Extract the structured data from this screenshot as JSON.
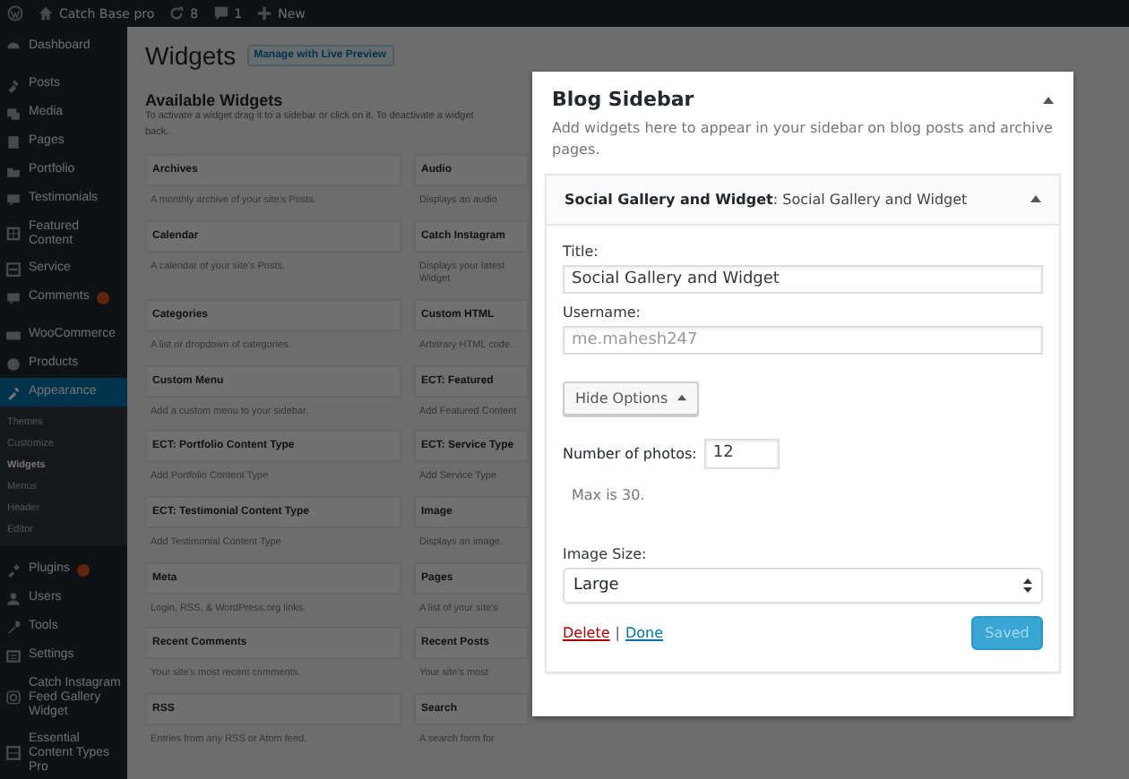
{
  "admin_bar": {
    "site": "Catch Base pro",
    "updates": "8",
    "comments": "1",
    "new": "New"
  },
  "sidebar": {
    "items": [
      {
        "label": "Dashboard",
        "selected": false,
        "badge": false
      },
      {
        "label": "Posts",
        "selected": false,
        "badge": false
      },
      {
        "label": "Media",
        "selected": false,
        "badge": false
      },
      {
        "label": "Pages",
        "selected": false,
        "badge": false
      },
      {
        "label": "Portfolio",
        "selected": false,
        "badge": false
      },
      {
        "label": "Testimonials",
        "selected": false,
        "badge": false
      },
      {
        "label": "Featured Content",
        "selected": false,
        "badge": false
      },
      {
        "label": "Service",
        "selected": false,
        "badge": false
      },
      {
        "label": "Comments",
        "selected": false,
        "badge": true
      },
      {
        "label": "WooCommerce",
        "selected": false,
        "badge": false
      },
      {
        "label": "Products",
        "selected": false,
        "badge": false
      },
      {
        "label": "Appearance",
        "selected": true,
        "badge": false,
        "children": [
          {
            "label": "Themes",
            "selected": false
          },
          {
            "label": "Customize",
            "selected": false
          },
          {
            "label": "Widgets",
            "selected": true
          },
          {
            "label": "Menus",
            "selected": false
          },
          {
            "label": "Header",
            "selected": false
          },
          {
            "label": "Editor",
            "selected": false
          }
        ]
      },
      {
        "label": "Plugins",
        "selected": false,
        "badge": true
      },
      {
        "label": "Users",
        "selected": false,
        "badge": false
      },
      {
        "label": "Tools",
        "selected": false,
        "badge": false
      },
      {
        "label": "Settings",
        "selected": false,
        "badge": false
      },
      {
        "label": "Catch Instagram Feed Gallery Widget",
        "selected": false,
        "badge": false
      },
      {
        "label": "Essential Content Types Pro",
        "selected": false,
        "badge": false
      }
    ]
  },
  "page": {
    "title": "Widgets",
    "action": "Manage with Live Preview"
  },
  "available_widgets": {
    "heading": "Available Widgets",
    "description_lines": [
      "To activate a widget drag it to a sidebar or click on it. To deactivate a widget",
      "back."
    ],
    "widgets": [
      {
        "title": "Archives",
        "description": "A monthly archive of your site's Posts."
      },
      {
        "title": "Audio",
        "description": "Displays an audio"
      },
      {
        "title": "Calendar",
        "description": "A calendar of your site's Posts."
      },
      {
        "title": "Catch Instagram",
        "description": "Displays your latest Widget"
      },
      {
        "title": "Categories",
        "description": "A list or dropdown of categories."
      },
      {
        "title": "Custom HTML",
        "description": "Arbitrary HTML code."
      },
      {
        "title": "Custom Menu",
        "description": "Add a custom menu to your sidebar."
      },
      {
        "title": "ECT: Featured",
        "description": "Add Featured Content"
      },
      {
        "title": "ECT: Portfolio Content Type",
        "description": "Add Portfolio Content Type"
      },
      {
        "title": "ECT: Service Type",
        "description": "Add Service Type"
      },
      {
        "title": "ECT: Testimonial Content Type",
        "description": "Add Testimonial Content Type"
      },
      {
        "title": "Image",
        "description": "Displays an image."
      },
      {
        "title": "Meta",
        "description": "Login, RSS, & WordPress.org links."
      },
      {
        "title": "Pages",
        "description": "A list of your site's"
      },
      {
        "title": "Recent Comments",
        "description": "Your site's most recent comments."
      },
      {
        "title": "Recent Posts",
        "description": "Your site's most"
      },
      {
        "title": "RSS",
        "description": "Entries from any RSS or Atom feed."
      },
      {
        "title": "Search",
        "description": "A search form for"
      }
    ]
  },
  "sidebar_panel": {
    "title": "Blog Sidebar",
    "expanded": true,
    "description": "Add widgets here to appear in your sidebar on blog posts and archive pages.",
    "widget": {
      "title": "**Social Gallery and Widget**: Social Gallery and Widget",
      "expanded": true,
      "title_field": {
        "label": "Title:",
        "value": "Social Gallery and Widget"
      },
      "username_field": {
        "label": "Username:",
        "placeholder": "me.mahesh247"
      },
      "options_button": "Hide Options",
      "photos_field": {
        "label": "Number of photos:",
        "value": "12"
      },
      "photos_note": "Max is 30.",
      "size_field": {
        "label": "Image Size:",
        "value": "Large"
      },
      "delete_link": "Delete",
      "separator": "|",
      "done_link": "Done",
      "save_button": {
        "label": "Saved",
        "disabled": true
      }
    }
  }
}
